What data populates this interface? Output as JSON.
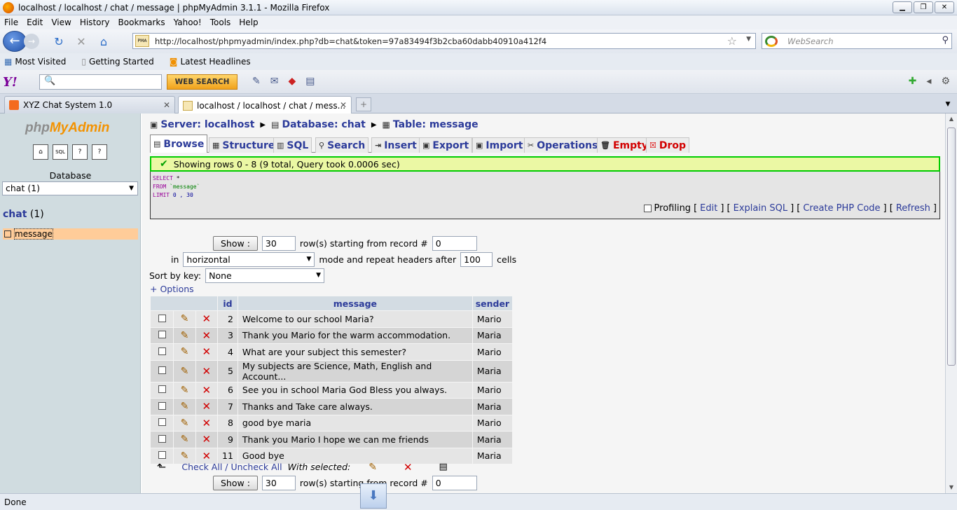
{
  "window": {
    "title": "localhost / localhost / chat / message | phpMyAdmin 3.1.1 - Mozilla Firefox",
    "min": "▁",
    "max": "❐",
    "close": "✕"
  },
  "menu": [
    "File",
    "Edit",
    "View",
    "History",
    "Bookmarks",
    "Yahoo!",
    "Tools",
    "Help"
  ],
  "nav": {
    "url": "http://localhost/phpmyadmin/index.php?db=chat&token=97a83494f3b2cba60dabb40910a412f4",
    "search_placeholder": "WebSearch",
    "pma_badge": "PMA"
  },
  "bookmarks": [
    "Most Visited",
    "Getting Started",
    "Latest Headlines"
  ],
  "yahoo": {
    "logo": "Y!",
    "button": "WEB SEARCH"
  },
  "tabs": [
    {
      "label": "XYZ Chat System 1.0",
      "active": false
    },
    {
      "label": "localhost / localhost / chat / mess...",
      "active": true
    }
  ],
  "sidebar": {
    "logo_a": "php",
    "logo_b": "MyAdmin",
    "database_label": "Database",
    "database_select": "chat (1)",
    "db_name": "chat",
    "db_count": "(1)",
    "table": "message",
    "icons": [
      "⌂",
      "SQL",
      "?",
      "?"
    ]
  },
  "breadcrumb": {
    "server": "Server: localhost",
    "database": "Database: chat",
    "table": "Table: message"
  },
  "main_tabs": [
    "Browse",
    "Structure",
    "SQL",
    "Search",
    "Insert",
    "Export",
    "Import",
    "Operations",
    "Empty",
    "Drop"
  ],
  "notice": "Showing rows 0 - 8 (9 total, Query took 0.0006 sec)",
  "sql": {
    "l1_kw": "SELECT",
    "l1_rest": " *",
    "l2_kw": "FROM",
    "l2_str": " `message`",
    "l3_kw": "LIMIT",
    "l3_num": " 0 , 30",
    "profiling": "Profiling",
    "links": [
      "Edit",
      "Explain SQL",
      "Create PHP Code",
      "Refresh"
    ]
  },
  "nav_form": {
    "show": "Show :",
    "rows": "30",
    "starting": "row(s) starting from record #",
    "start": "0",
    "in": "in",
    "mode": "horizontal",
    "mode_suffix": "mode and repeat headers after",
    "repeat": "100",
    "cells": "cells",
    "sort_label": "Sort by key:",
    "sort": "None",
    "options": "+ Options"
  },
  "table": {
    "headers": [
      "id",
      "message",
      "sender"
    ],
    "rows": [
      {
        "id": "2",
        "message": "Welcome to our school Maria?",
        "sender": "Mario"
      },
      {
        "id": "3",
        "message": "Thank you Mario for the warm accommodation.",
        "sender": "Maria"
      },
      {
        "id": "4",
        "message": "What are your subject this semester?",
        "sender": "Mario"
      },
      {
        "id": "5",
        "message": "My subjects are Science, Math, English and Account...",
        "sender": "Maria"
      },
      {
        "id": "6",
        "message": "See you in school Maria God Bless you always.",
        "sender": "Mario"
      },
      {
        "id": "7",
        "message": "Thanks and Take care always.",
        "sender": "Maria"
      },
      {
        "id": "8",
        "message": "good bye maria",
        "sender": "Mario"
      },
      {
        "id": "9",
        "message": "Thank you Mario I hope we can me friends",
        "sender": "Maria"
      },
      {
        "id": "11",
        "message": "Good bye",
        "sender": "Maria"
      }
    ]
  },
  "checkall": {
    "check": "Check All",
    "sep": " / ",
    "uncheck": "Uncheck All",
    "with_selected": "With selected:"
  },
  "status": "Done",
  "colors": {
    "pma_link": "#2c3b9a",
    "sidebar_bg": "#d0dce0",
    "notice_border": "#00cc00",
    "selected_table": "#ffcc99"
  }
}
